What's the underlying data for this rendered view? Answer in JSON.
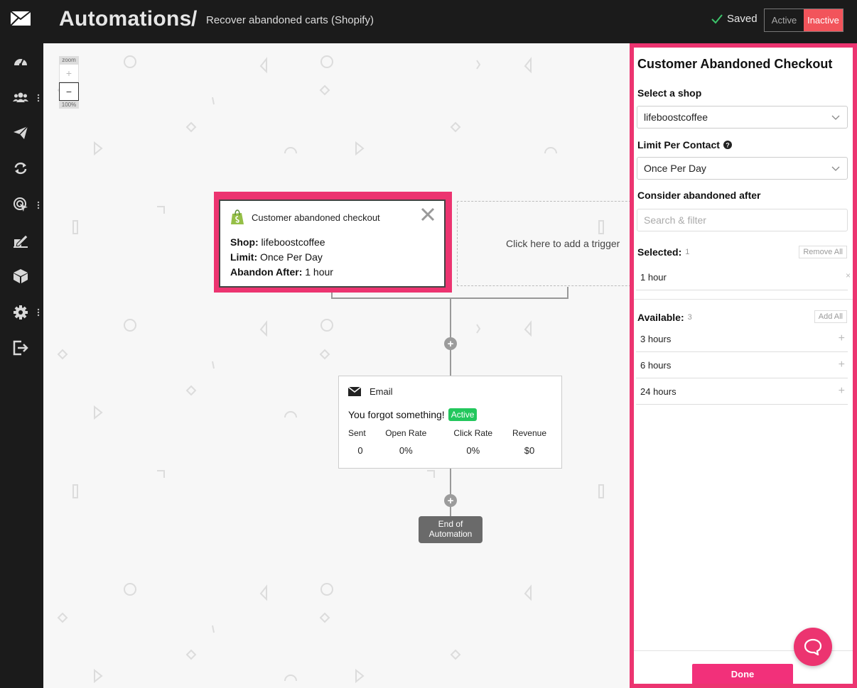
{
  "header": {
    "title": "Automations",
    "separator": "/",
    "subtitle": "Recover abandoned carts (Shopify)",
    "saved_label": "Saved",
    "toggle_active": "Active",
    "toggle_inactive": "Inactive"
  },
  "sidebar": {
    "items": [
      {
        "icon": "dashboard-icon"
      },
      {
        "icon": "contacts-icon"
      },
      {
        "icon": "campaigns-icon"
      },
      {
        "icon": "automations-icon"
      },
      {
        "icon": "targeting-icon"
      },
      {
        "icon": "forms-icon"
      },
      {
        "icon": "products-icon"
      },
      {
        "icon": "settings-icon"
      },
      {
        "icon": "logout-icon"
      }
    ]
  },
  "canvas": {
    "zoom_label": "zoom",
    "zoom_in": "+",
    "zoom_out": "−",
    "zoom_level": "100%",
    "trigger": {
      "title": "Customer abandoned checkout",
      "shop_label": "Shop:",
      "shop_value": "lifeboostcoffee",
      "limit_label": "Limit:",
      "limit_value": "Once Per Day",
      "abandon_label": "Abandon After:",
      "abandon_value": "1 hour"
    },
    "add_trigger_text": "Click here to add a trigger",
    "email": {
      "type_label": "Email",
      "subject": "You forgot something!",
      "status_badge": "Active",
      "stats_headers": [
        "Sent",
        "Open Rate",
        "Click Rate",
        "Revenue"
      ],
      "stats_values": [
        "0",
        "0%",
        "0%",
        "$0"
      ]
    },
    "end_label_line1": "End of",
    "end_label_line2": "Automation"
  },
  "panel": {
    "title": "Customer Abandoned Checkout",
    "shop_label": "Select a shop",
    "shop_value": "lifeboostcoffee",
    "limit_label": "Limit Per Contact",
    "limit_value": "Once Per Day",
    "abandon_label": "Consider abandoned after",
    "search_placeholder": "Search & filter",
    "selected_label": "Selected:",
    "selected_count": "1",
    "remove_all": "Remove All",
    "selected_items": [
      "1 hour"
    ],
    "available_label": "Available:",
    "available_count": "3",
    "add_all": "Add All",
    "available_items": [
      "3 hours",
      "6 hours",
      "24 hours"
    ],
    "done_label": "Done"
  },
  "colors": {
    "accent": "#ec3470",
    "header_bg": "#1b1b1b",
    "inactive_red": "#f2545b",
    "active_green": "#23c75d"
  }
}
